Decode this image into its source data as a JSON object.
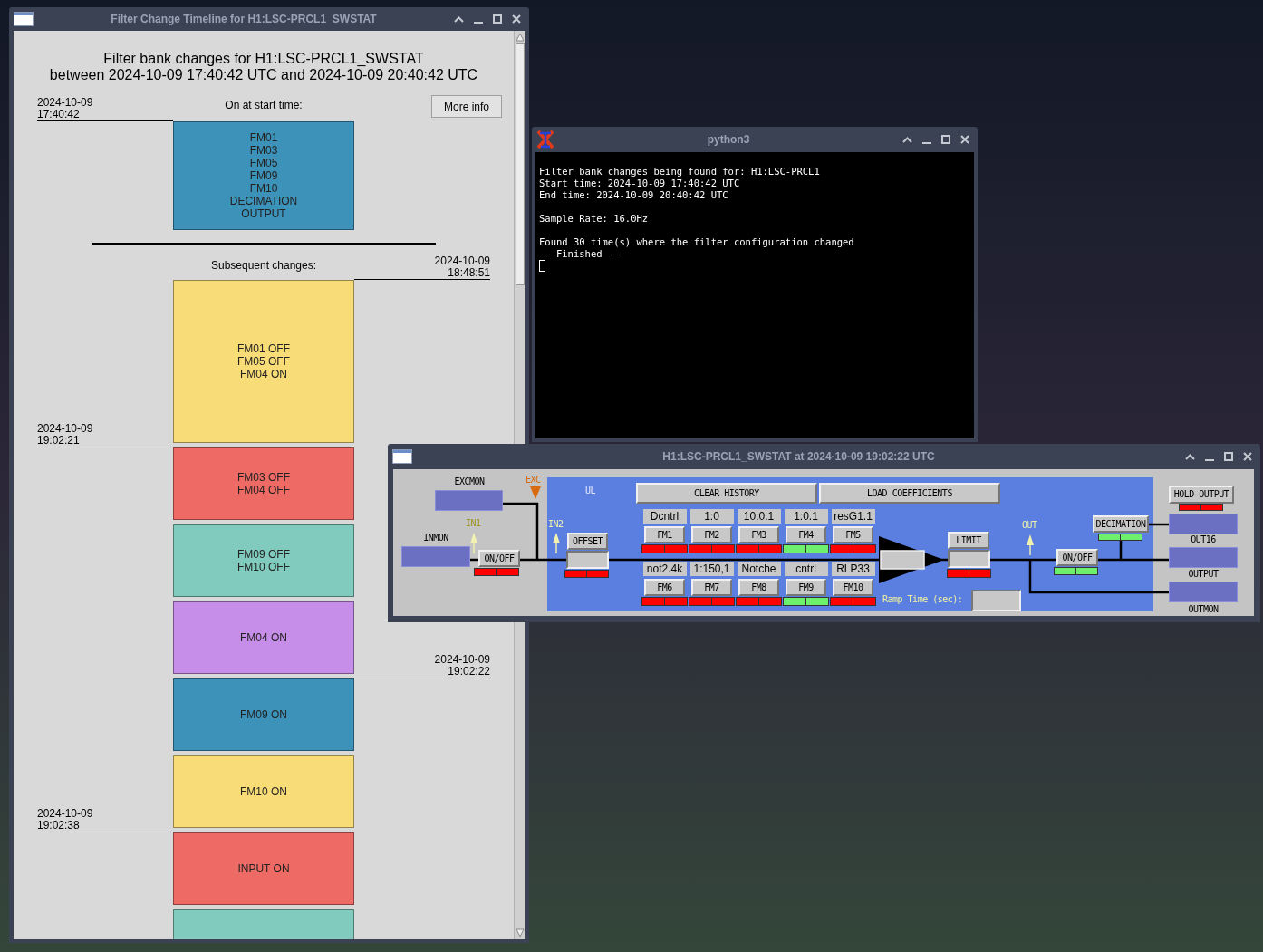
{
  "timeline_window": {
    "title": "Filter Change Timeline for H1:LSC-PRCL1_SWSTAT",
    "heading": [
      "Filter bank changes for H1:LSC-PRCL1_SWSTAT",
      "between 2024-10-09 17:40:42 UTC and 2024-10-09 20:40:42 UTC"
    ],
    "start_timestamp": {
      "date": "2024-10-09",
      "time": "17:40:42"
    },
    "start_label": "On at start time:",
    "more_info_button": "More info",
    "start_block": {
      "color": "#3d92b9",
      "lines": [
        "FM01",
        "FM03",
        "FM05",
        "FM09",
        "FM10",
        "DECIMATION",
        "OUTPUT"
      ]
    },
    "changes_label": "Subsequent changes:",
    "changes": [
      {
        "color": "#f8dc78",
        "lines": [
          "FM01 OFF",
          "FM05 OFF",
          "FM04 ON"
        ],
        "right_marker": {
          "date": "2024-10-09",
          "time": "18:48:51"
        }
      },
      {
        "color": "#ee6a64",
        "lines": [
          "FM03 OFF",
          "FM04 OFF"
        ],
        "left_marker": {
          "date": "2024-10-09",
          "time": "19:02:21"
        }
      },
      {
        "color": "#80cbbd",
        "lines": [
          "FM09 OFF",
          "FM10 OFF"
        ]
      },
      {
        "color": "#c68ee8",
        "lines": [
          "FM04 ON"
        ]
      },
      {
        "color": "#3d92b9",
        "lines": [
          "FM09 ON"
        ],
        "right_marker": {
          "date": "2024-10-09",
          "time": "19:02:22"
        }
      },
      {
        "color": "#f8dc78",
        "lines": [
          "FM10 ON"
        ]
      },
      {
        "color": "#ee6a64",
        "lines": [
          "INPUT ON"
        ],
        "left_marker": {
          "date": "2024-10-09",
          "time": "19:02:38"
        }
      },
      {
        "color": "#80cbbd"
      }
    ]
  },
  "terminal_window": {
    "title": "python3",
    "paragraphs": [
      [
        "Filter bank changes being found for: H1:LSC-PRCL1",
        "Start time: 2024-10-09 17:40:42 UTC",
        "End time: 2024-10-09 20:40:42 UTC"
      ],
      [
        "Sample Rate: 16.0Hz"
      ],
      [
        "Found 30 time(s) where the filter configuration changed",
        "-- Finished --"
      ]
    ]
  },
  "filter_window": {
    "title": "H1:LSC-PRCL1_SWSTAT at 2024-10-09 19:02:22 UTC",
    "excmon_label": "EXCMON",
    "exc_label": "EXC",
    "inmon_label": "INMON",
    "in1_label": "IN1",
    "ul_label": "UL",
    "in2_label": "IN2",
    "input_switch": {
      "label": "ON/OFF",
      "on": false
    },
    "offset": {
      "label": "OFFSET",
      "on": false
    },
    "clear_history": "CLEAR HISTORY",
    "load_coefficients": "LOAD COEFFICIENTS",
    "filters": [
      {
        "label": "Dcntrl",
        "button": "FM1",
        "on": false
      },
      {
        "label": "1:0",
        "button": "FM2",
        "on": false
      },
      {
        "label": "10:0.1",
        "button": "FM3",
        "on": false
      },
      {
        "label": "1:0.1",
        "button": "FM4",
        "on": true
      },
      {
        "label": "resG1.1",
        "button": "FM5",
        "on": false
      },
      {
        "label": "not2.4k",
        "button": "FM6",
        "on": false
      },
      {
        "label": "1:150,1",
        "button": "FM7",
        "on": false
      },
      {
        "label": "Notche",
        "button": "FM8",
        "on": false
      },
      {
        "label": "cntrl",
        "button": "FM9",
        "on": true
      },
      {
        "label": "RLP33",
        "button": "FM10",
        "on": false
      }
    ],
    "limit": {
      "label": "LIMIT",
      "on": false
    },
    "out_label": "OUT",
    "output_switch": {
      "label": "ON/OFF",
      "on": true
    },
    "decimation": {
      "label": "DECIMATION",
      "on": true
    },
    "hold_output": {
      "label": "HOLD OUTPUT",
      "on": false
    },
    "out16_label": "OUT16",
    "output_label": "OUTPUT",
    "outmon_label": "OUTMON",
    "ramp_time_label": "Ramp Time (sec):"
  }
}
